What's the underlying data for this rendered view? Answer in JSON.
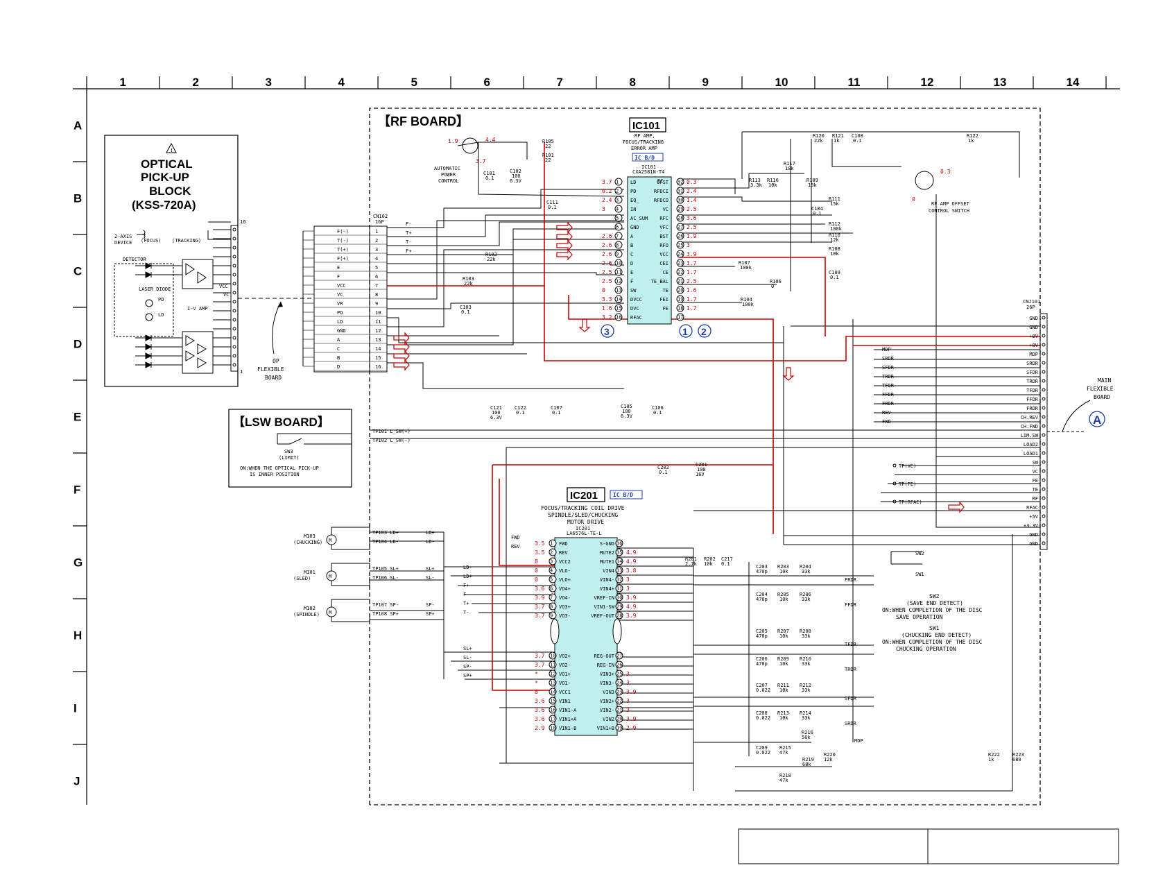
{
  "columns": [
    "1",
    "2",
    "3",
    "4",
    "5",
    "6",
    "7",
    "8",
    "9",
    "10",
    "11",
    "12",
    "13",
    "14"
  ],
  "rows": [
    "A",
    "B",
    "C",
    "D",
    "E",
    "F",
    "G",
    "H",
    "I",
    "J"
  ],
  "rf_board": {
    "title": "【RF BOARD】"
  },
  "lsw_board": {
    "title": "【LSW BOARD】",
    "switch": "SW3",
    "switch_sub": "(LIMIT)",
    "note1": "ON:WHEN THE OPTICAL PICK-UP",
    "note2": "IS INNER POSITION"
  },
  "optical": {
    "title1": "OPTICAL",
    "title2": "PICK-UP",
    "title3": "BLOCK",
    "title4": "(KSS-720A)",
    "two_axis": "2-AXIS",
    "device": "DEVICE",
    "focus": "(FOCUS)",
    "tracking": "(TRACKING)",
    "detector": "DETECTOR",
    "laser_diode": "LASER DIODE",
    "pd": "PD",
    "ld": "LD",
    "iv_amp": "I-V AMP",
    "vcc": "VCC",
    "vc": "VC",
    "pin16": "16",
    "pin1": "1"
  },
  "op_flex": {
    "l1": "OP",
    "l2": "FLEXIBLE",
    "l3": "BOARD"
  },
  "cn102": {
    "name": "CN102",
    "pins_label": "16P",
    "labels": [
      "F(-)",
      "T(-)",
      "T(+)",
      "F(+)",
      "E",
      "F",
      "VCC",
      "VC",
      "VR",
      "PD",
      "LD",
      "GND",
      "A",
      "C",
      "B",
      "D"
    ],
    "nums": [
      "1",
      "2",
      "3",
      "4",
      "5",
      "6",
      "7",
      "8",
      "9",
      "10",
      "11",
      "12",
      "13",
      "14",
      "15",
      "16"
    ],
    "outs": [
      "F-",
      "T+",
      "T-",
      "F+"
    ]
  },
  "apc": {
    "label1": "AUTOMATIC",
    "label2": "POWER",
    "label3": "CONTROL",
    "v1": "1.9",
    "v2": "4.4",
    "v3": "3.7",
    "r105": "R105",
    "r105v": "22",
    "r101": "R101",
    "r101v": "22",
    "c101": "C101",
    "c101v": "0.1",
    "c102": "C102",
    "c102v1": "100",
    "c102v2": "6.3V"
  },
  "ic101": {
    "name": "IC101",
    "func1": "RF AMP,",
    "func2": "FOCUS/TRACKING",
    "func3": "ERROR AMP",
    "badge": "IC B/D",
    "part1": "IC101",
    "part2": "CXA2581N-T4",
    "left_pins": [
      {
        "n": "1",
        "l": "LD",
        "v": "3.7"
      },
      {
        "n": "2",
        "l": "PD",
        "v": "0.2"
      },
      {
        "n": "3",
        "l": "EQ_",
        "v": "2.4"
      },
      {
        "n": "4",
        "l": "IN",
        "v": "3"
      },
      {
        "n": "5",
        "l": "AC_SUM",
        "v": ""
      },
      {
        "n": "6",
        "l": "GND",
        "v": ""
      },
      {
        "n": "7",
        "l": "A",
        "v": "2.6"
      },
      {
        "n": "8",
        "l": "B",
        "v": "2.6"
      },
      {
        "n": "9",
        "l": "C",
        "v": "2.6"
      },
      {
        "n": "10",
        "l": "D",
        "v": "2.6"
      },
      {
        "n": "11",
        "l": "E",
        "v": "2.5"
      },
      {
        "n": "12",
        "l": "F",
        "v": "2.5"
      },
      {
        "n": "13",
        "l": "SW",
        "v": "0"
      },
      {
        "n": "14",
        "l": "DVCC",
        "v": "3.3"
      },
      {
        "n": "15",
        "l": "DVC",
        "v": "1.6"
      },
      {
        "n": "16",
        "l": "RFAC",
        "v": "3.2"
      }
    ],
    "right_pins": [
      {
        "n": "32",
        "l": "OFST",
        "v": "0.3"
      },
      {
        "n": "31",
        "l": "RFDCI",
        "v": "2.4"
      },
      {
        "n": "30",
        "l": "RFDCO",
        "v": "1.4"
      },
      {
        "n": "29",
        "l": "VC",
        "v": "2.5"
      },
      {
        "n": "28",
        "l": "RFC",
        "v": "3.6"
      },
      {
        "n": "27",
        "l": "VFC",
        "v": "2.5"
      },
      {
        "n": "26",
        "l": "BST",
        "v": "1.9"
      },
      {
        "n": "25",
        "l": "RFO",
        "v": "3"
      },
      {
        "n": "24",
        "l": "VCC",
        "v": "3.9"
      },
      {
        "n": "23",
        "l": "CEI",
        "v": "1.7"
      },
      {
        "n": "22",
        "l": "CE",
        "v": "1.7"
      },
      {
        "n": "21",
        "l": "TE_BAL",
        "v": "2.5"
      },
      {
        "n": "20",
        "l": "TE",
        "v": "1.6"
      },
      {
        "n": "19",
        "l": "FEI",
        "v": "1.7"
      },
      {
        "n": "18",
        "l": "FE",
        "v": "1.7"
      },
      {
        "n": "17",
        "l": "",
        "v": ""
      }
    ],
    "ec": "EC"
  },
  "ic201": {
    "name": "IC201",
    "badge": "IC B/D",
    "func1": "FOCUS/TRACKING COIL DRIVE",
    "func2": "SPINDLE/SLED/CHUCKING",
    "func3": "MOTOR DRIVE",
    "part1": "IC201",
    "part2": "LA6576L-TE-L",
    "left_pins": [
      {
        "n": "1",
        "l": "FWD",
        "v": "3.5"
      },
      {
        "n": "2",
        "l": "REV",
        "v": "3.5"
      },
      {
        "n": "3",
        "l": "VCC2",
        "v": "8"
      },
      {
        "n": "4",
        "l": "VLO-",
        "v": "0"
      },
      {
        "n": "5",
        "l": "VLO+",
        "v": "0"
      },
      {
        "n": "6",
        "l": "VO4+",
        "v": "3.6"
      },
      {
        "n": "7",
        "l": "VO4-",
        "v": "3.9"
      },
      {
        "n": "8",
        "l": "VO3+",
        "v": "3.7"
      },
      {
        "n": "9",
        "l": "VO3-",
        "v": "3.7"
      },
      {
        "n": "10",
        "l": "VO2+",
        "v": "3.7"
      },
      {
        "n": "11",
        "l": "VO2-",
        "v": "3.7"
      },
      {
        "n": "12",
        "l": "VO1+",
        "v": "*"
      },
      {
        "n": "13",
        "l": "VO1-",
        "v": "*"
      },
      {
        "n": "14",
        "l": "VCC1",
        "v": "8"
      },
      {
        "n": "15",
        "l": "VIN1",
        "v": "3.6"
      },
      {
        "n": "16",
        "l": "VIN1-A",
        "v": "3.6"
      },
      {
        "n": "17",
        "l": "VIN1+A",
        "v": "3.6"
      },
      {
        "n": "18",
        "l": "VIN1-B",
        "v": "2.9"
      }
    ],
    "right_pins": [
      {
        "n": "36",
        "l": "S-GND",
        "v": ""
      },
      {
        "n": "35",
        "l": "MUTE2",
        "v": "4.9"
      },
      {
        "n": "34",
        "l": "MUTE1",
        "v": "4.9"
      },
      {
        "n": "33",
        "l": "VIN4",
        "v": "3.8"
      },
      {
        "n": "32",
        "l": "VIN4-",
        "v": "3"
      },
      {
        "n": "31",
        "l": "VIN4+",
        "v": "3"
      },
      {
        "n": "30",
        "l": "VREF-IN",
        "v": "3.9"
      },
      {
        "n": "29",
        "l": "VIN1-SW",
        "v": "4.9"
      },
      {
        "n": "28",
        "l": "VREF-OUT",
        "v": "3.9"
      },
      {
        "n": "27",
        "l": "REG-OUT",
        "v": ""
      },
      {
        "n": "26",
        "l": "REG-IN",
        "v": ""
      },
      {
        "n": "25",
        "l": "VIN3+",
        "v": "3"
      },
      {
        "n": "24",
        "l": "VIN3-",
        "v": "3"
      },
      {
        "n": "23",
        "l": "VIN3",
        "v": "3.9"
      },
      {
        "n": "22",
        "l": "VIN2+",
        "v": "3"
      },
      {
        "n": "21",
        "l": "VIN2-",
        "v": "3"
      },
      {
        "n": "20",
        "l": "VIN2",
        "v": "3.9"
      },
      {
        "n": "19",
        "l": "VIN1+B",
        "v": "2.9"
      }
    ]
  },
  "cnj101": {
    "name": "CNJ101",
    "pins_label": "26P",
    "labels": [
      "GND",
      "GND",
      "+8V",
      "+8V",
      "MDP",
      "SRDR",
      "SFDR",
      "TRDR",
      "TFDR",
      "FFDR",
      "FRDR",
      "CH.REV",
      "CH.FWD",
      "LIM.SW",
      "LOAD2",
      "LOAD1",
      "SW",
      "VC",
      "FE",
      "TE",
      "RF",
      "RFAC",
      "+5V",
      "+3.3V",
      "GND",
      "GND"
    ]
  },
  "main_flex": {
    "l1": "MAIN",
    "l2": "FLEXIBLE",
    "l3": "BOARD",
    "marker": "A"
  },
  "left_nets": [
    "MDP",
    "SRDR",
    "SFDR",
    "TRDR",
    "TFDR",
    "FFDR",
    "FRDR",
    "REV",
    "FWD"
  ],
  "tps": {
    "tp101": "TP101 L_SW(+)",
    "tp102": "TP102 L_SW(-)",
    "tp_vc": "TP(VC)",
    "tp_te": "TP(TE)",
    "tp_rfac": "TP(RFAC)"
  },
  "motors": [
    {
      "name": "M103",
      "sub": "(CHUCKING)",
      "tp1": "TP103 LD+",
      "tp2": "TP104 LD-",
      "n1": "LD+",
      "n2": "LD-"
    },
    {
      "name": "M101",
      "sub": "(SLED)",
      "tp1": "TP105 SL+",
      "tp2": "TP106 SL-",
      "n1": "SL+",
      "n2": "SL-"
    },
    {
      "name": "M102",
      "sub": "(SPINDLE)",
      "tp1": "TP107 SP-",
      "tp2": "TP108 SP+",
      "n1": "SP-",
      "n2": "SP+"
    }
  ],
  "ic201_in_nets": [
    "LD-",
    "LD+",
    "F+",
    "F-",
    "T+",
    "T-",
    "SL+",
    "SL-",
    "SP-",
    "SP+"
  ],
  "rf_offset": {
    "l1": "RF AMP OFFSET",
    "l2": "CONTROL SWITCH",
    "v1": "0.3",
    "v2": "0"
  },
  "sw2": {
    "name": "SW2",
    "l1": "(SAVE END DETECT)",
    "l2": "ON:WHEN COMPLETION OF THE DISC",
    "l3": "SAVE OPERATION"
  },
  "sw1": {
    "name": "SW1",
    "l1": "(CHUCKING END DETECT)",
    "l2": "ON:WHEN COMPLETION OF THE DISC",
    "l3": "CHUCKING OPERATION"
  },
  "sw_small": [
    "SW2",
    "SW1"
  ],
  "resistors_top": [
    {
      "n": "R120",
      "v": "22k"
    },
    {
      "n": "R121",
      "v": "1k"
    },
    {
      "n": "C108",
      "v": "0.1"
    },
    {
      "n": "R122",
      "v": "1k"
    },
    {
      "n": "R117",
      "v": "10k"
    },
    {
      "n": "R113",
      "v": "3.3k"
    },
    {
      "n": "R116",
      "v": "10k"
    },
    {
      "n": "R109",
      "v": "18k"
    },
    {
      "n": "R111",
      "v": "15k"
    },
    {
      "n": "C104",
      "v": "0.1"
    },
    {
      "n": "R112",
      "v": "100k"
    },
    {
      "n": "R110",
      "v": "12k"
    },
    {
      "n": "R108",
      "v": "10k"
    },
    {
      "n": "C109",
      "v": "0.1"
    },
    {
      "n": "R107",
      "v": "100k"
    },
    {
      "n": "R106",
      "v": "0"
    },
    {
      "n": "R104",
      "v": "100k"
    },
    {
      "n": "C111",
      "v": "0.1"
    },
    {
      "n": "R102",
      "v": "22k"
    },
    {
      "n": "R103",
      "v": "22k"
    },
    {
      "n": "C103",
      "v": "0.1"
    }
  ],
  "caps_mid": [
    {
      "n": "C121",
      "v1": "100",
      "v2": "6.3V"
    },
    {
      "n": "C122",
      "v1": "0.1",
      "v2": ""
    },
    {
      "n": "C107",
      "v1": "0.1",
      "v2": ""
    },
    {
      "n": "C105",
      "v1": "100",
      "v2": "6.3V"
    },
    {
      "n": "C106",
      "v1": "0.1",
      "v2": ""
    },
    {
      "n": "C202",
      "v1": "0.1",
      "v2": ""
    },
    {
      "n": "C201",
      "v1": "100",
      "v2": "16V"
    }
  ],
  "ic201_rc": [
    {
      "n": "R201",
      "v": "2.7k"
    },
    {
      "n": "R202",
      "v": "10k"
    },
    {
      "n": "C217",
      "v": "0.1"
    }
  ],
  "filters": [
    {
      "c": "C203",
      "cv": "470p",
      "r1": "R203",
      "r1v": "10k",
      "r2": "R204",
      "r2v": "33k",
      "out": "FRDR"
    },
    {
      "c": "C204",
      "cv": "470p",
      "r1": "R205",
      "r1v": "10k",
      "r2": "R206",
      "r2v": "33k",
      "out": "FFDR"
    },
    {
      "c": "C205",
      "cv": "470p",
      "r1": "R207",
      "r1v": "10k",
      "r2": "R208",
      "r2v": "33k",
      "out": "TFDR"
    },
    {
      "c": "C206",
      "cv": "470p",
      "r1": "R209",
      "r1v": "10k",
      "r2": "R210",
      "r2v": "33k",
      "out": "TRDR"
    },
    {
      "c": "C207",
      "cv": "0.022",
      "r1": "R211",
      "r1v": "10k",
      "r2": "R212",
      "r2v": "33k",
      "out": "SFDR"
    },
    {
      "c": "C208",
      "cv": "0.022",
      "r1": "R213",
      "r1v": "10k",
      "r2": "R214",
      "r2v": "33k",
      "out": "SRDR"
    }
  ],
  "misc": [
    {
      "n": "R216",
      "v": "56k"
    },
    {
      "n": "C209",
      "v": "0.022"
    },
    {
      "n": "R215",
      "v": "47k"
    },
    {
      "n": "R219",
      "v": "68k"
    },
    {
      "n": "R220",
      "v": "12k"
    },
    {
      "n": "R218",
      "v": "47k"
    },
    {
      "n": "R222",
      "v": "1k"
    },
    {
      "n": "R223",
      "v": "680"
    }
  ],
  "mdp_label": "MDP",
  "circles": [
    "1",
    "2",
    "3"
  ],
  "colors": {
    "wire": "#000000",
    "power": "#c80000",
    "ic_fill": "#bff0ee",
    "badge": "#1a3caa",
    "voltage": "#c80000"
  }
}
